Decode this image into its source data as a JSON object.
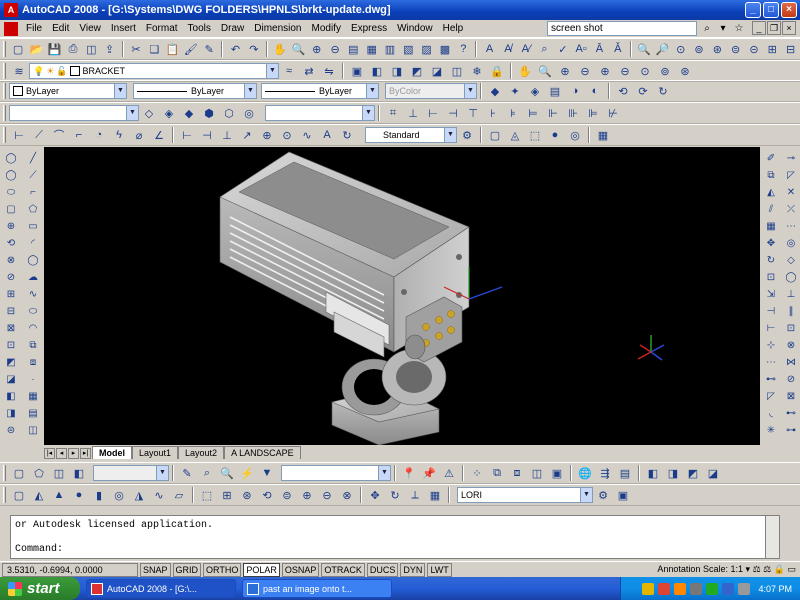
{
  "window": {
    "title": "AutoCAD 2008 - [G:\\Systems\\DWG FOLDERS\\HPNLS\\brkt-update.dwg]"
  },
  "menu": {
    "items": [
      "File",
      "Edit",
      "View",
      "Insert",
      "Format",
      "Tools",
      "Draw",
      "Dimension",
      "Modify",
      "Express",
      "Window",
      "Help"
    ],
    "search_value": "screen shot"
  },
  "layers": {
    "current_layer": "BRACKET"
  },
  "properties": {
    "color": "ByLayer",
    "linetype": "ByLayer",
    "lineweight": "ByLayer",
    "plotstyle": "ByColor"
  },
  "dimstyle": {
    "current": "Standard"
  },
  "workspace": {
    "current": "LORI"
  },
  "layout_tabs": [
    "Model",
    "Layout1",
    "Layout2",
    "A LANDSCAPE"
  ],
  "command": {
    "history_line": "or Autodesk licensed application.",
    "prompt": "Command:"
  },
  "status": {
    "coordinates": "3.5310, -0.6994, 0.0000",
    "buttons": [
      {
        "label": "SNAP",
        "on": false
      },
      {
        "label": "GRID",
        "on": false
      },
      {
        "label": "ORTHO",
        "on": false
      },
      {
        "label": "POLAR",
        "on": true
      },
      {
        "label": "OSNAP",
        "on": false
      },
      {
        "label": "OTRACK",
        "on": false
      },
      {
        "label": "DUCS",
        "on": false
      },
      {
        "label": "DYN",
        "on": false
      },
      {
        "label": "LWT",
        "on": false
      }
    ],
    "annotation_scale_label": "Annotation Scale:",
    "annotation_scale_value": "1:1"
  },
  "taskbar": {
    "start_label": "start",
    "items": [
      "AutoCAD 2008 - [G:\\...",
      "past an image onto t..."
    ],
    "clock": "4:07 PM"
  },
  "colors": {
    "title_blue": "#0a3fb8",
    "drawing_bg": "#000000",
    "taskbar_blue": "#245dd7",
    "start_green": "#2f8a2f"
  }
}
